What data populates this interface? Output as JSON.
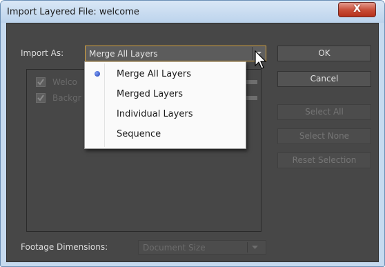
{
  "window": {
    "title": "Import Layered File: welcome",
    "close_glyph": "X"
  },
  "import_as": {
    "label": "Import As:",
    "selected": "Merge All Layers"
  },
  "layers": [
    {
      "name": "Welco",
      "checked": true
    },
    {
      "name": "Backgr",
      "checked": true
    }
  ],
  "buttons": {
    "ok": "OK",
    "cancel": "Cancel",
    "select_all": "Select All",
    "select_none": "Select None",
    "reset_selection": "Reset Selection"
  },
  "footage": {
    "label": "Footage Dimensions:",
    "value": "Document Size"
  },
  "menu": {
    "items": [
      {
        "label": "Merge All Layers",
        "selected": true
      },
      {
        "label": "Merged Layers",
        "selected": false
      },
      {
        "label": "Individual Layers",
        "selected": false
      },
      {
        "label": "Sequence",
        "selected": false
      }
    ]
  },
  "colors": {
    "accent_border": "#d8a53f",
    "close_button": "#c74b35",
    "panel_bg": "#474747"
  },
  "icons": [
    "close-icon",
    "chevron-down-icon",
    "checkmark-icon",
    "radio-dot-icon",
    "mouse-cursor-icon"
  ]
}
